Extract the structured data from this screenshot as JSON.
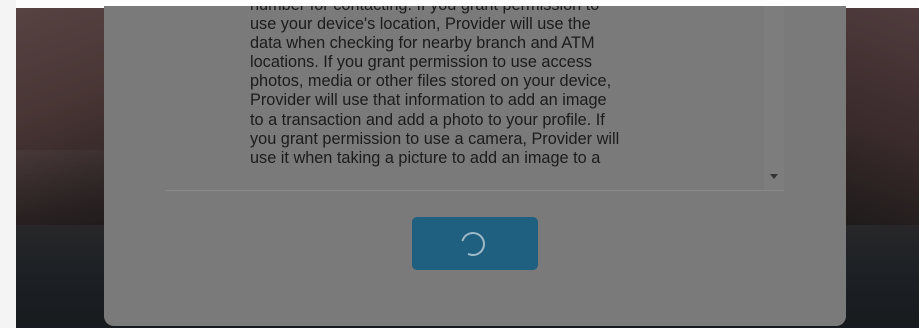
{
  "consent": {
    "lines": [
      "number for contacting. If you grant permission to",
      "use your device's location, Provider will use the",
      "data when checking for nearby branch and ATM",
      "locations. If you grant permission to use access",
      "photos, media or other files stored on your device,",
      "Provider will use that information to add an image",
      "to a transaction and add a photo to your profile. If",
      "you grant permission to use a camera, Provider will",
      "use it when taking a picture to add an image to a"
    ]
  },
  "submit_button": {
    "state": "loading",
    "icon": "spinner-icon"
  },
  "colors": {
    "button": "#1f5f80",
    "spinner": "#9fb9c8",
    "dialog": "#7a7a7a",
    "text": "#1b1b1b"
  }
}
